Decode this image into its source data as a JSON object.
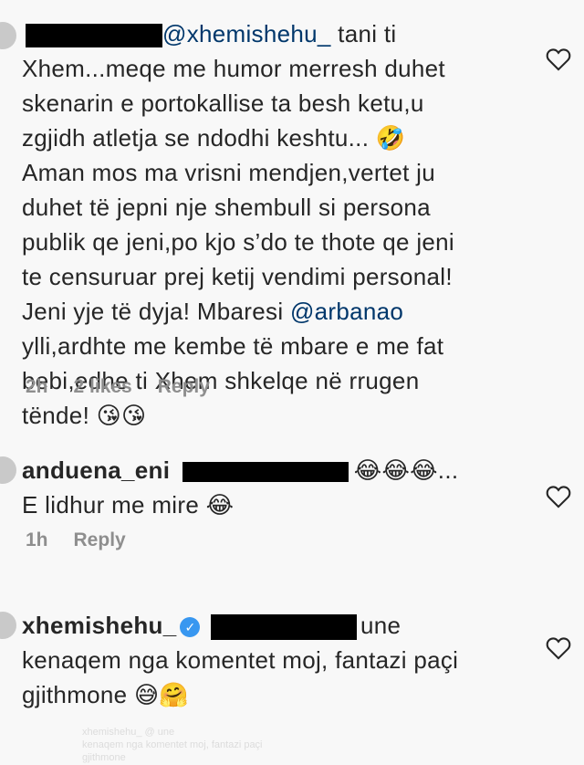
{
  "comments": [
    {
      "mention": "@xhemishehu_",
      "lines": [
        " tani ti",
        "Xhem...meqe me humor merresh duhet",
        "skenarin e portokallise ta besh ketu,u",
        "zgjidh atletja se ndodhi keshtu... 🤣",
        "Aman mos ma vrisni mendjen,vertet ju",
        "duhet të jepni nje shembull si persona",
        "publik qe jeni,po kjo s’do te thote qe jeni",
        "te censuruar prej ketij vendimi personal!",
        "Jeni yje të dyja! Mbaresi "
      ],
      "mention2": "@arbanao",
      "lines2": [
        "ylli,ardhte me kembe të mbare e me fat",
        "bebi,edhe ti Xhem shkelqe në rrugen",
        "tënde! 😘😘"
      ],
      "time": "2h",
      "likes": "2 likes",
      "reply": "Reply"
    },
    {
      "username": "anduena_eni",
      "tail": "😂😂😂...",
      "line2": "E lidhur me mire 😂",
      "time": "1h",
      "reply": "Reply"
    },
    {
      "username": "xhemishehu_",
      "verified": "✓",
      "tail": "une",
      "line2": "kenaqem nga komentet moj, fantazi paçi",
      "line3": "gjithmone 😅🤗"
    }
  ],
  "ghost_text": [
    "xhemishehu_ @ une",
    "kenaqem nga komentet moj, fantazi paçi",
    "gjithmone"
  ]
}
